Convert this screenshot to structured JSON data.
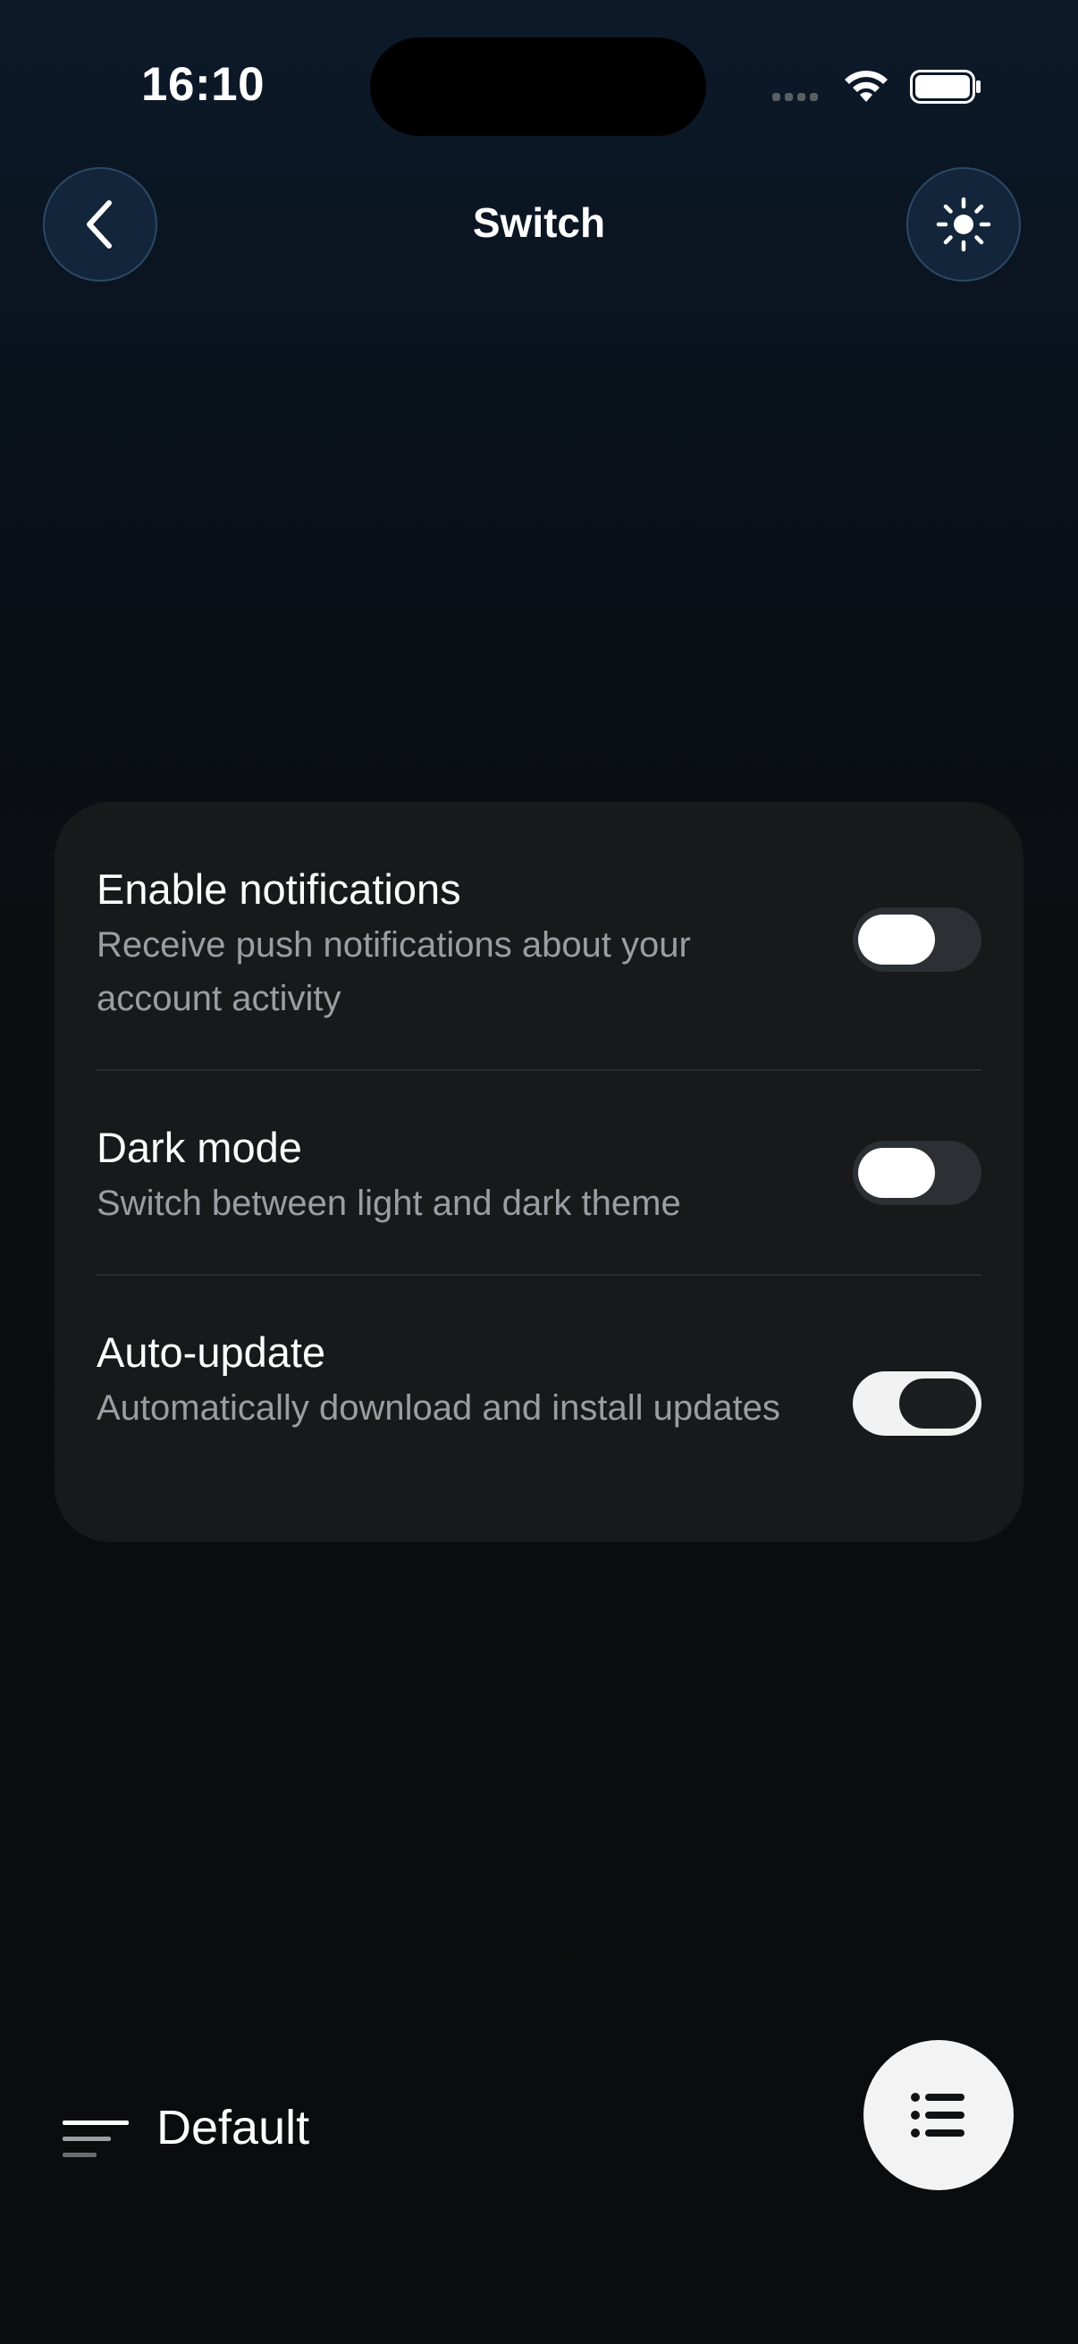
{
  "status_bar": {
    "time": "16:10"
  },
  "header": {
    "title": "Switch",
    "back_icon": "chevron-left-icon",
    "theme_icon": "sun-icon"
  },
  "settings": {
    "items": [
      {
        "title": "Enable notifications",
        "description": "Receive push notifications about your account activity",
        "enabled": false
      },
      {
        "title": "Dark mode",
        "description": "Switch between light and dark theme",
        "enabled": false
      },
      {
        "title": "Auto-update",
        "description": "Automatically download and install updates",
        "enabled": true
      }
    ]
  },
  "bottom_bar": {
    "variant_label": "Default",
    "variant_icon": "sort-lines-icon",
    "fab_icon": "list-icon"
  },
  "colors": {
    "card_background": "#17191b",
    "description_text": "#9a9ea3",
    "header_button": "#13253a",
    "fab_background": "#f3f3f3"
  }
}
